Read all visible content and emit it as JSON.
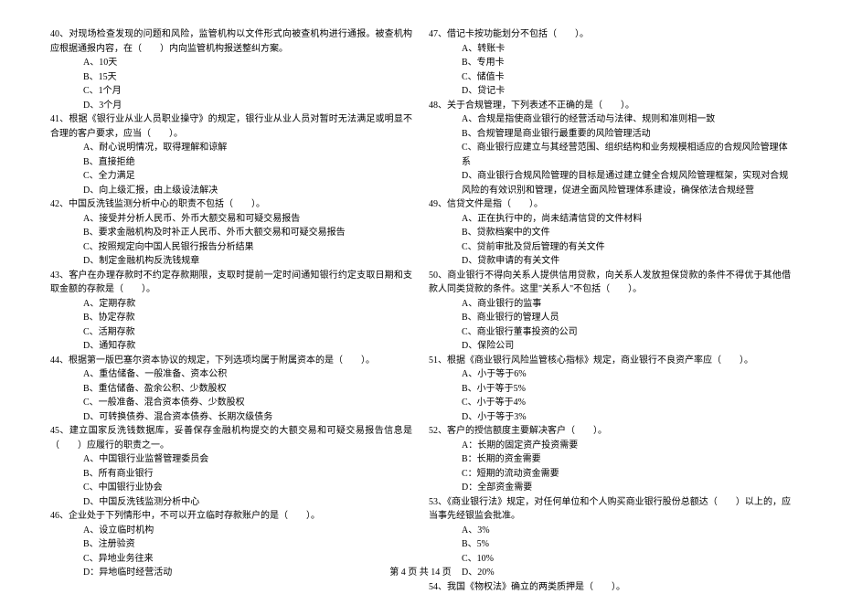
{
  "left": {
    "q40": {
      "text": "40、对现场检查发现的问题和风险，监管机构以文件形式向被查机构进行通报。被查机构应根据通报内容，在（　　）内向监管机构报送整纠方案。",
      "a": "A、10天",
      "b": "B、15天",
      "c": "C、1个月",
      "d": "D、3个月"
    },
    "q41": {
      "text": "41、根据《银行业从业人员职业操守》的规定，银行业从业人员对暂时无法满足或明显不合理的客户要求，应当（　　）。",
      "a": "A、耐心说明情况，取得理解和谅解",
      "b": "B、直接拒绝",
      "c": "C、全力满足",
      "d": "D、向上级汇报，由上级设法解决"
    },
    "q42": {
      "text": "42、中国反洗钱监测分析中心的职责不包括（　　）。",
      "a": "A、接受并分析人民币、外币大额交易和可疑交易报告",
      "b": "B、要求金融机构及时补正人民币、外币大额交易和可疑交易报告",
      "c": "C、按照规定向中国人民银行报告分析结果",
      "d": "D、制定金融机构反洗钱规章"
    },
    "q43": {
      "text": "43、客户在办理存款时不约定存款期限，支取时提前一定时间通知银行约定支取日期和支取金额的存款是（　　）。",
      "a": "A、定期存款",
      "b": "B、协定存款",
      "c": "C、活期存款",
      "d": "D、通知存款"
    },
    "q44": {
      "text": "44、根据第一版巴塞尔资本协议的规定，下列选项均属于附属资本的是（　　）。",
      "a": "A、重估储备、一般准备、资本公积",
      "b": "B、重估储备、盈余公积、少数股权",
      "c": "C、一般准备、混合资本债券、少数股权",
      "d": "D、可转换债券、混合资本债券、长期次级债务"
    },
    "q45": {
      "text": "45、建立国家反洗钱数据库，妥善保存金融机构提交的大额交易和可疑交易报告信息是（　　）应履行的职责之一。",
      "a": "A、中国银行业监督管理委员会",
      "b": "B、所有商业银行",
      "c": "C、中国银行业协会",
      "d": "D、中国反洗钱监测分析中心"
    },
    "q46": {
      "text": "46、企业处于下列情形中，不可以开立临时存款账户的是（　　）。",
      "a": "A、设立临时机构",
      "b": "B、注册验资",
      "c": "C、异地业务往来",
      "d": "D：异地临时经营活动"
    }
  },
  "right": {
    "q47": {
      "text": "47、借记卡按功能划分不包括（　　）。",
      "a": "A、转账卡",
      "b": "B、专用卡",
      "c": "C、储值卡",
      "d": "D、贷记卡"
    },
    "q48": {
      "text": "48、关于合规管理，下列表述不正确的是（　　）。",
      "a": "A、合规是指使商业银行的经营活动与法律、规则和准则相一致",
      "b": "B、合规管理是商业银行最重要的风险管理活动",
      "c": "C、商业银行应建立与其经营范围、组织结构和业务规模相适应的合规风险管理体系",
      "d": "D、商业银行合规风险管理的目标是通过建立健全合规风险管理框架，实现对合规风险的有效识别和管理，促进全面风险管理体系建设，确保依法合规经营"
    },
    "q49": {
      "text": "49、信贷文件是指（　　）。",
      "a": "A、正在执行中的，尚未结清信贷的文件材料",
      "b": "B、贷款档案中的文件",
      "c": "C、贷前审批及贷后管理的有关文件",
      "d": "D、贷款申请的有关文件"
    },
    "q50": {
      "text": "50、商业银行不得向关系人提供信用贷款，向关系人发放担保贷款的条件不得优于其他借款人同类贷款的条件。这里\"关系人\"不包括（　　）。",
      "a": "A、商业银行的监事",
      "b": "B、商业银行的管理人员",
      "c": "C、商业银行董事投资的公司",
      "d": "D、保险公司"
    },
    "q51": {
      "text": "51、根据《商业银行风险监管核心指标》规定，商业银行不良资产率应（　　）。",
      "a": "A、小于等于6%",
      "b": "B、小于等于5%",
      "c": "C、小于等于4%",
      "d": "D、小于等于3%"
    },
    "q52": {
      "text": "52、客户的授信额度主要解决客户（　　）。",
      "a": "A：长期的固定资产投资需要",
      "b": "B：长期的资金需要",
      "c": "C：短期的流动资金需要",
      "d": "D：全部资金需要"
    },
    "q53": {
      "text": "53、《商业银行法》规定，对任何单位和个人购买商业银行股份总额达（　　）以上的，应当事先经银监会批准。",
      "a": "A、3%",
      "b": "B、5%",
      "c": "C、10%",
      "d": "D、20%"
    },
    "q54": {
      "text": "54、我国《物权法》确立的两类质押是（　　）。"
    }
  },
  "footer": "第 4 页 共 14 页"
}
